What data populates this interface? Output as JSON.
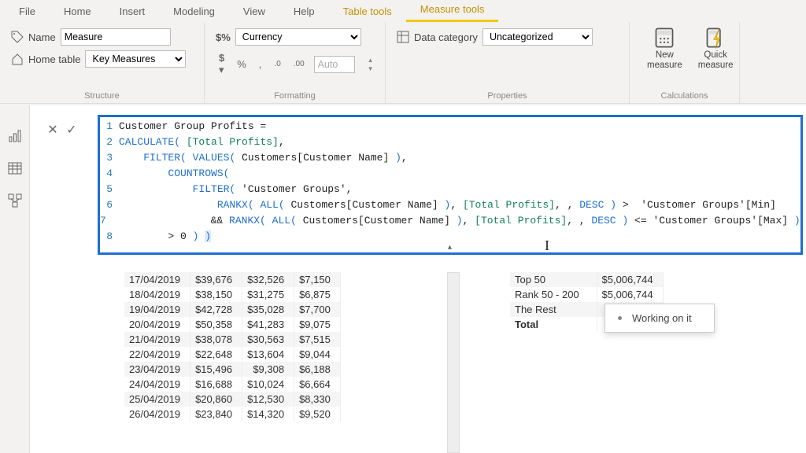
{
  "menu": {
    "file": "File",
    "home": "Home",
    "insert": "Insert",
    "modeling": "Modeling",
    "view": "View",
    "help": "Help",
    "tabletools": "Table tools",
    "measuretools": "Measure tools"
  },
  "ribbon": {
    "structure": {
      "label": "Structure",
      "name_lbl": "Name",
      "name_val": "Measure",
      "home_lbl": "Home table",
      "home_val": "Key Measures"
    },
    "formatting": {
      "label": "Formatting",
      "type": "Currency",
      "dollar": "$",
      "percent": "%",
      "comma": ",",
      "dec_up": ".0",
      "dec_dn": ".00",
      "auto": "Auto"
    },
    "properties": {
      "label": "Properties",
      "cat_lbl": "Data category",
      "cat_val": "Uncategorized"
    },
    "calc": {
      "label": "Calculations",
      "new_measure": "New\nmeasure",
      "quick_measure": "Quick\nmeasure"
    }
  },
  "formula": {
    "lines": [
      "Customer Group Profits =",
      "CALCULATE( [Total Profits],",
      "    FILTER( VALUES( Customers[Customer Name] ),",
      "        COUNTROWS(",
      "            FILTER( 'Customer Groups',",
      "                RANKX( ALL( Customers[Customer Name] ), [Total Profits], , DESC ) >  'Customer Groups'[Min]",
      "                && RANKX( ALL( Customers[Customer Name] ), [Total Profits], , DESC ) <= 'Customer Groups'[Max] ) )",
      "        > 0 ) )"
    ]
  },
  "tableA": {
    "rows": [
      [
        "17/04/2019",
        "$39,676",
        "$32,526",
        "$7,150"
      ],
      [
        "18/04/2019",
        "$38,150",
        "$31,275",
        "$6,875"
      ],
      [
        "19/04/2019",
        "$42,728",
        "$35,028",
        "$7,700"
      ],
      [
        "20/04/2019",
        "$50,358",
        "$41,283",
        "$9,075"
      ],
      [
        "21/04/2019",
        "$38,078",
        "$30,563",
        "$7,515"
      ],
      [
        "22/04/2019",
        "$22,648",
        "$13,604",
        "$9,044"
      ],
      [
        "23/04/2019",
        "$15,496",
        "$9,308",
        "$6,188"
      ],
      [
        "24/04/2019",
        "$16,688",
        "$10,024",
        "$6,664"
      ],
      [
        "25/04/2019",
        "$20,860",
        "$12,530",
        "$8,330"
      ],
      [
        "26/04/2019",
        "$23,840",
        "$14,320",
        "$9,520"
      ]
    ]
  },
  "tableB": {
    "rows": [
      [
        "Top 50",
        "$5,006,744"
      ],
      [
        "Rank 50 - 200",
        "$5,006,744"
      ],
      [
        "The Rest",
        "$"
      ],
      [
        "Total",
        "$5"
      ]
    ]
  },
  "tip": "Working on it"
}
